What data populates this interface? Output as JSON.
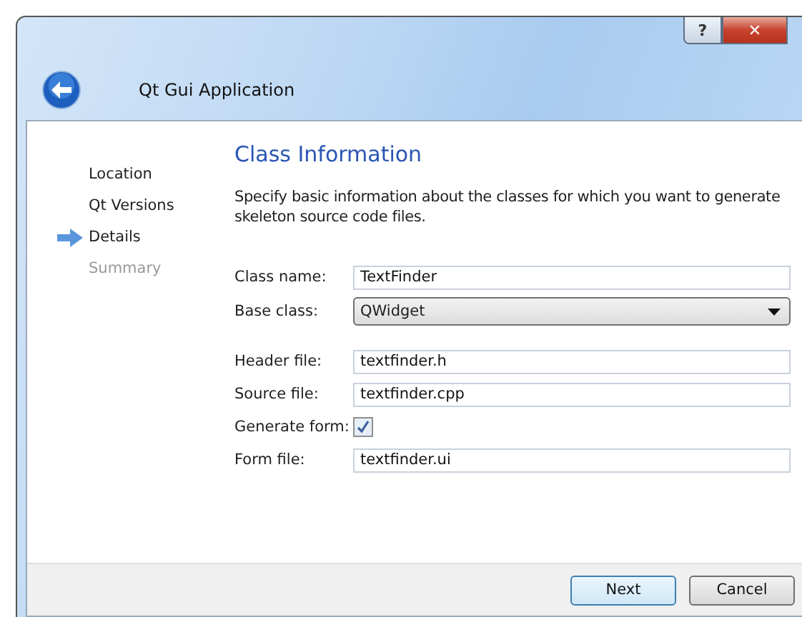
{
  "window": {
    "title": "Qt Gui Application",
    "help_button": "?",
    "close_button": "✕"
  },
  "steps": [
    {
      "label": "Location",
      "current": false,
      "disabled": false
    },
    {
      "label": "Qt Versions",
      "current": false,
      "disabled": false
    },
    {
      "label": "Details",
      "current": true,
      "disabled": false
    },
    {
      "label": "Summary",
      "current": false,
      "disabled": true
    }
  ],
  "page": {
    "title": "Class Information",
    "description": "Specify basic information about the classes for which you want to generate skeleton source code files."
  },
  "class_fields": [
    {
      "label": "Class name:",
      "kind": "text",
      "value": "TextFinder"
    },
    {
      "label": "Base class:",
      "kind": "combo",
      "value": "QWidget"
    }
  ],
  "file_fields": [
    {
      "label": "Header file:",
      "kind": "text",
      "value": "textfinder.h"
    },
    {
      "label": "Source file:",
      "kind": "text",
      "value": "textfinder.cpp"
    },
    {
      "label": "Generate form:",
      "kind": "checkbox",
      "checked": true
    },
    {
      "label": "Form file:",
      "kind": "text",
      "value": "textfinder.ui"
    }
  ],
  "buttons": [
    {
      "label": "Next",
      "default": true
    },
    {
      "label": "Cancel",
      "default": false
    }
  ]
}
